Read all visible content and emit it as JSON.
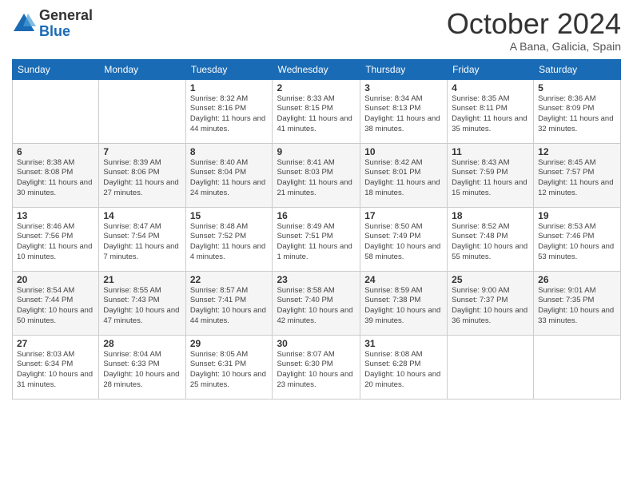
{
  "header": {
    "logo_general": "General",
    "logo_blue": "Blue",
    "month_title": "October 2024",
    "location": "A Bana, Galicia, Spain"
  },
  "days_of_week": [
    "Sunday",
    "Monday",
    "Tuesday",
    "Wednesday",
    "Thursday",
    "Friday",
    "Saturday"
  ],
  "weeks": [
    [
      {
        "day": "",
        "sunrise": "",
        "sunset": "",
        "daylight": ""
      },
      {
        "day": "",
        "sunrise": "",
        "sunset": "",
        "daylight": ""
      },
      {
        "day": "1",
        "sunrise": "Sunrise: 8:32 AM",
        "sunset": "Sunset: 8:16 PM",
        "daylight": "Daylight: 11 hours and 44 minutes."
      },
      {
        "day": "2",
        "sunrise": "Sunrise: 8:33 AM",
        "sunset": "Sunset: 8:15 PM",
        "daylight": "Daylight: 11 hours and 41 minutes."
      },
      {
        "day": "3",
        "sunrise": "Sunrise: 8:34 AM",
        "sunset": "Sunset: 8:13 PM",
        "daylight": "Daylight: 11 hours and 38 minutes."
      },
      {
        "day": "4",
        "sunrise": "Sunrise: 8:35 AM",
        "sunset": "Sunset: 8:11 PM",
        "daylight": "Daylight: 11 hours and 35 minutes."
      },
      {
        "day": "5",
        "sunrise": "Sunrise: 8:36 AM",
        "sunset": "Sunset: 8:09 PM",
        "daylight": "Daylight: 11 hours and 32 minutes."
      }
    ],
    [
      {
        "day": "6",
        "sunrise": "Sunrise: 8:38 AM",
        "sunset": "Sunset: 8:08 PM",
        "daylight": "Daylight: 11 hours and 30 minutes."
      },
      {
        "day": "7",
        "sunrise": "Sunrise: 8:39 AM",
        "sunset": "Sunset: 8:06 PM",
        "daylight": "Daylight: 11 hours and 27 minutes."
      },
      {
        "day": "8",
        "sunrise": "Sunrise: 8:40 AM",
        "sunset": "Sunset: 8:04 PM",
        "daylight": "Daylight: 11 hours and 24 minutes."
      },
      {
        "day": "9",
        "sunrise": "Sunrise: 8:41 AM",
        "sunset": "Sunset: 8:03 PM",
        "daylight": "Daylight: 11 hours and 21 minutes."
      },
      {
        "day": "10",
        "sunrise": "Sunrise: 8:42 AM",
        "sunset": "Sunset: 8:01 PM",
        "daylight": "Daylight: 11 hours and 18 minutes."
      },
      {
        "day": "11",
        "sunrise": "Sunrise: 8:43 AM",
        "sunset": "Sunset: 7:59 PM",
        "daylight": "Daylight: 11 hours and 15 minutes."
      },
      {
        "day": "12",
        "sunrise": "Sunrise: 8:45 AM",
        "sunset": "Sunset: 7:57 PM",
        "daylight": "Daylight: 11 hours and 12 minutes."
      }
    ],
    [
      {
        "day": "13",
        "sunrise": "Sunrise: 8:46 AM",
        "sunset": "Sunset: 7:56 PM",
        "daylight": "Daylight: 11 hours and 10 minutes."
      },
      {
        "day": "14",
        "sunrise": "Sunrise: 8:47 AM",
        "sunset": "Sunset: 7:54 PM",
        "daylight": "Daylight: 11 hours and 7 minutes."
      },
      {
        "day": "15",
        "sunrise": "Sunrise: 8:48 AM",
        "sunset": "Sunset: 7:52 PM",
        "daylight": "Daylight: 11 hours and 4 minutes."
      },
      {
        "day": "16",
        "sunrise": "Sunrise: 8:49 AM",
        "sunset": "Sunset: 7:51 PM",
        "daylight": "Daylight: 11 hours and 1 minute."
      },
      {
        "day": "17",
        "sunrise": "Sunrise: 8:50 AM",
        "sunset": "Sunset: 7:49 PM",
        "daylight": "Daylight: 10 hours and 58 minutes."
      },
      {
        "day": "18",
        "sunrise": "Sunrise: 8:52 AM",
        "sunset": "Sunset: 7:48 PM",
        "daylight": "Daylight: 10 hours and 55 minutes."
      },
      {
        "day": "19",
        "sunrise": "Sunrise: 8:53 AM",
        "sunset": "Sunset: 7:46 PM",
        "daylight": "Daylight: 10 hours and 53 minutes."
      }
    ],
    [
      {
        "day": "20",
        "sunrise": "Sunrise: 8:54 AM",
        "sunset": "Sunset: 7:44 PM",
        "daylight": "Daylight: 10 hours and 50 minutes."
      },
      {
        "day": "21",
        "sunrise": "Sunrise: 8:55 AM",
        "sunset": "Sunset: 7:43 PM",
        "daylight": "Daylight: 10 hours and 47 minutes."
      },
      {
        "day": "22",
        "sunrise": "Sunrise: 8:57 AM",
        "sunset": "Sunset: 7:41 PM",
        "daylight": "Daylight: 10 hours and 44 minutes."
      },
      {
        "day": "23",
        "sunrise": "Sunrise: 8:58 AM",
        "sunset": "Sunset: 7:40 PM",
        "daylight": "Daylight: 10 hours and 42 minutes."
      },
      {
        "day": "24",
        "sunrise": "Sunrise: 8:59 AM",
        "sunset": "Sunset: 7:38 PM",
        "daylight": "Daylight: 10 hours and 39 minutes."
      },
      {
        "day": "25",
        "sunrise": "Sunrise: 9:00 AM",
        "sunset": "Sunset: 7:37 PM",
        "daylight": "Daylight: 10 hours and 36 minutes."
      },
      {
        "day": "26",
        "sunrise": "Sunrise: 9:01 AM",
        "sunset": "Sunset: 7:35 PM",
        "daylight": "Daylight: 10 hours and 33 minutes."
      }
    ],
    [
      {
        "day": "27",
        "sunrise": "Sunrise: 8:03 AM",
        "sunset": "Sunset: 6:34 PM",
        "daylight": "Daylight: 10 hours and 31 minutes."
      },
      {
        "day": "28",
        "sunrise": "Sunrise: 8:04 AM",
        "sunset": "Sunset: 6:33 PM",
        "daylight": "Daylight: 10 hours and 28 minutes."
      },
      {
        "day": "29",
        "sunrise": "Sunrise: 8:05 AM",
        "sunset": "Sunset: 6:31 PM",
        "daylight": "Daylight: 10 hours and 25 minutes."
      },
      {
        "day": "30",
        "sunrise": "Sunrise: 8:07 AM",
        "sunset": "Sunset: 6:30 PM",
        "daylight": "Daylight: 10 hours and 23 minutes."
      },
      {
        "day": "31",
        "sunrise": "Sunrise: 8:08 AM",
        "sunset": "Sunset: 6:28 PM",
        "daylight": "Daylight: 10 hours and 20 minutes."
      },
      {
        "day": "",
        "sunrise": "",
        "sunset": "",
        "daylight": ""
      },
      {
        "day": "",
        "sunrise": "",
        "sunset": "",
        "daylight": ""
      }
    ]
  ]
}
